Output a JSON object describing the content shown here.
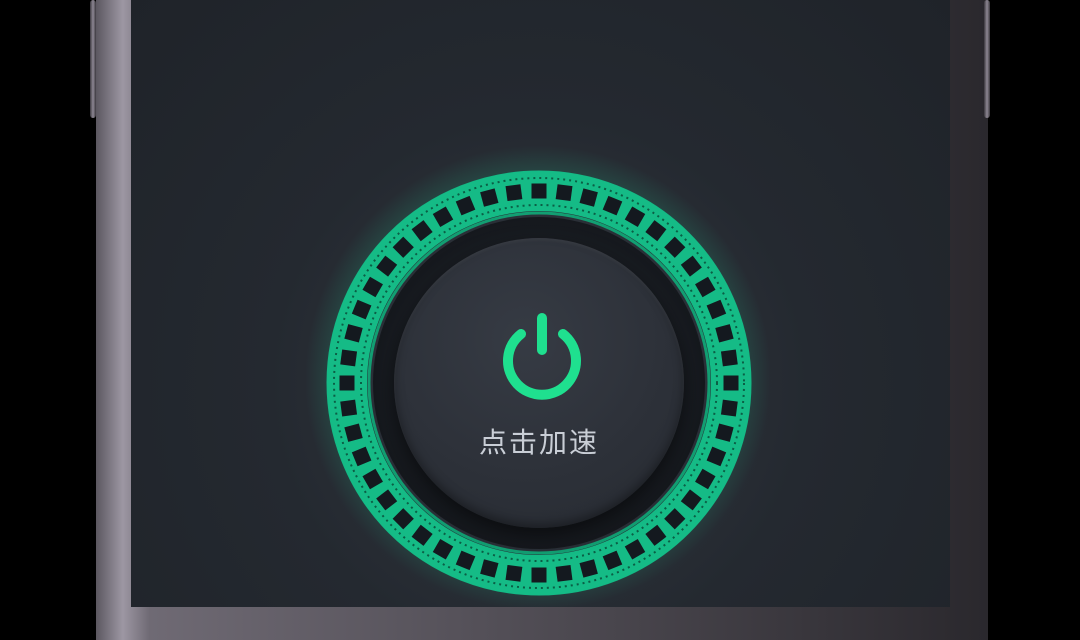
{
  "button": {
    "label": "点击加速",
    "icon": "power-icon",
    "accent": "#1fe08f"
  },
  "colors": {
    "ring": "#16c38a",
    "screen_bg": "#2a2f37"
  }
}
